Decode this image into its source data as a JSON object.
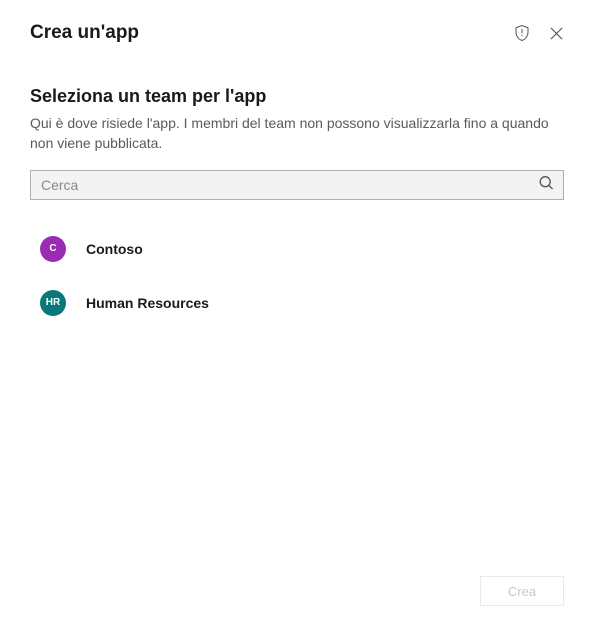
{
  "header": {
    "title": "Crea un'app"
  },
  "section": {
    "title": "Seleziona un team per l'app",
    "description": "Qui è dove risiede l'app. I membri del team non possono visualizzarla fino a quando non viene pubblicata."
  },
  "search": {
    "placeholder": "Cerca",
    "value": ""
  },
  "teams": [
    {
      "name": "Contoso",
      "initials": "C",
      "avatarColor": "#9c2bb3"
    },
    {
      "name": "Human Resources",
      "initials": "HR",
      "avatarColor": "#0a787a"
    }
  ],
  "footer": {
    "createLabel": "Crea"
  }
}
